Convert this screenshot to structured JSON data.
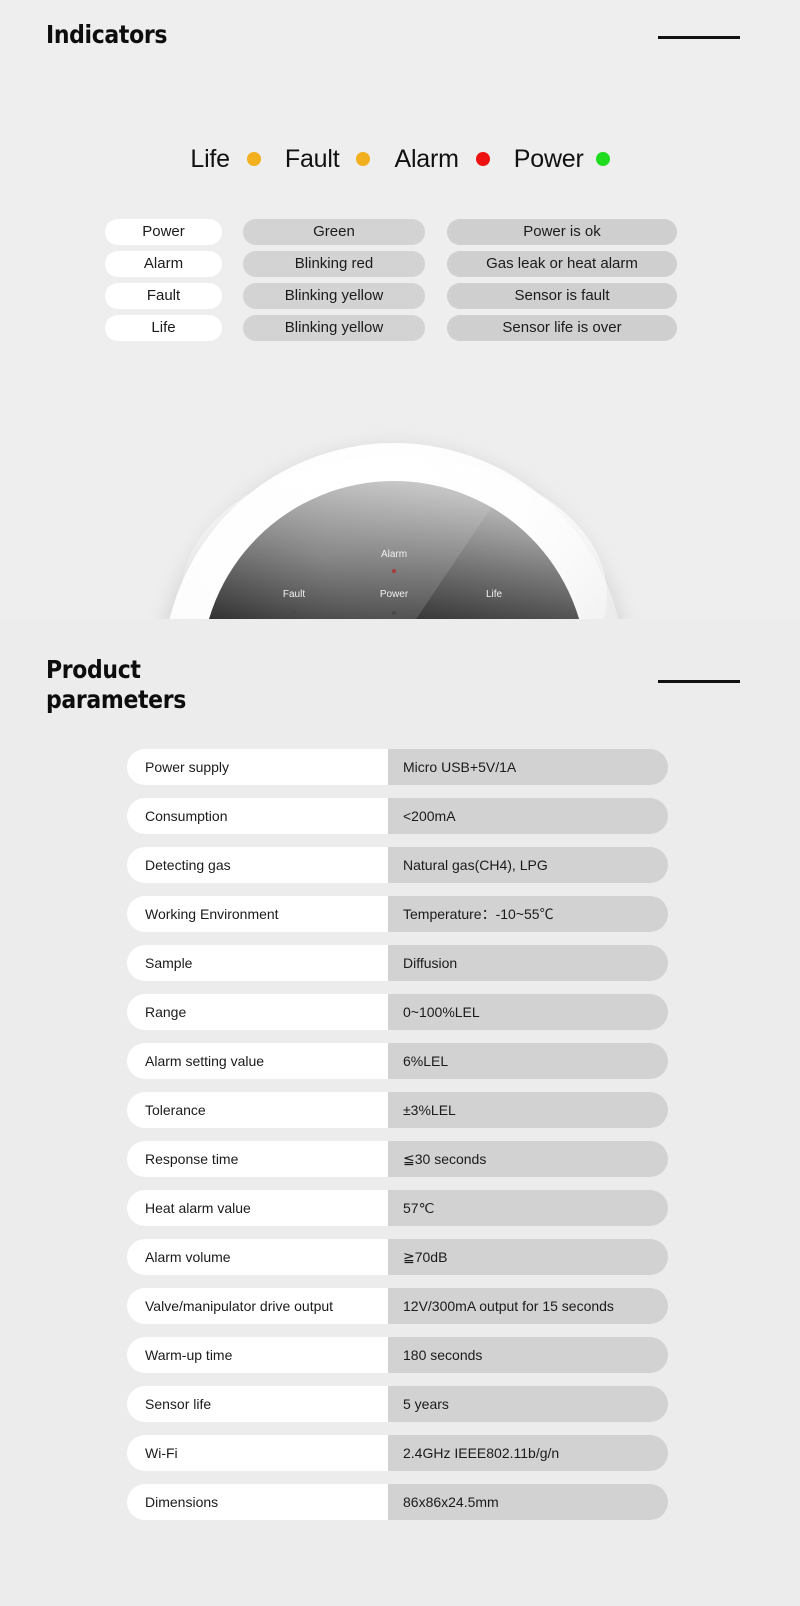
{
  "indicators_section": {
    "title": "Indicators",
    "legend": [
      {
        "label": "Life",
        "color": "#f2b01e"
      },
      {
        "label": "Fault",
        "color": "#f2b01e"
      },
      {
        "label": "Alarm",
        "color": "#ee1111"
      },
      {
        "label": "Power",
        "color": "#1fdc1f"
      }
    ],
    "table": {
      "rows": [
        {
          "name": "Power",
          "behavior": "Green",
          "meaning": "Power is ok"
        },
        {
          "name": "Alarm",
          "behavior": "Blinking red",
          "meaning": "Gas leak or heat alarm"
        },
        {
          "name": "Fault",
          "behavior": "Blinking yellow",
          "meaning": "Sensor is fault"
        },
        {
          "name": "Life",
          "behavior": "Blinking yellow",
          "meaning": "Sensor life is over"
        }
      ]
    },
    "device_photo": {
      "alarm_label": "Alarm",
      "fault_label": "Fault",
      "power_label": "Power",
      "life_label": "Life"
    }
  },
  "parameters_section": {
    "title": "Product\nparameters",
    "rows": [
      {
        "key": "Power supply",
        "value": "Micro USB+5V/1A"
      },
      {
        "key": "Consumption",
        "value": "<200mA"
      },
      {
        "key": "Detecting gas",
        "value": "Natural gas(CH4), LPG"
      },
      {
        "key": "Working Environment",
        "value": "Temperature：-10~55℃"
      },
      {
        "key": "Sample",
        "value": "Diffusion"
      },
      {
        "key": "Range",
        "value": "0~100%LEL"
      },
      {
        "key": "Alarm setting value",
        "value": "6%LEL"
      },
      {
        "key": "Tolerance",
        "value": "±3%LEL"
      },
      {
        "key": "Response time",
        "value": "≦30 seconds"
      },
      {
        "key": "Heat alarm value",
        "value": "57℃"
      },
      {
        "key": "Alarm volume",
        "value": "≧70dB"
      },
      {
        "key": "Valve/manipulator drive output",
        "value": "12V/300mA output for 15 seconds"
      },
      {
        "key": "Warm-up time",
        "value": "180 seconds"
      },
      {
        "key": "Sensor life",
        "value": "5 years"
      },
      {
        "key": "Wi-Fi",
        "value": "2.4GHz IEEE802.11b/g/n"
      },
      {
        "key": "Dimensions",
        "value": "86x86x24.5mm"
      }
    ]
  }
}
